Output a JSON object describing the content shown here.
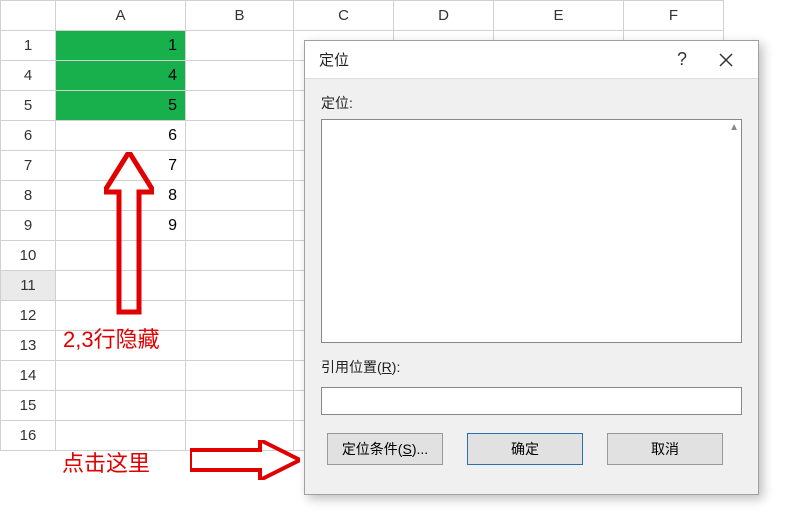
{
  "columns": [
    "A",
    "B",
    "C",
    "D",
    "E",
    "F"
  ],
  "rows": [
    {
      "hdr": "1",
      "a": "1",
      "green": true
    },
    {
      "hdr": "4",
      "a": "4",
      "green": true
    },
    {
      "hdr": "5",
      "a": "5",
      "green": true
    },
    {
      "hdr": "6",
      "a": "6"
    },
    {
      "hdr": "7",
      "a": "7"
    },
    {
      "hdr": "8",
      "a": "8"
    },
    {
      "hdr": "9",
      "a": "9"
    },
    {
      "hdr": "10",
      "a": ""
    },
    {
      "hdr": "11",
      "a": "",
      "selected": true
    },
    {
      "hdr": "12",
      "a": ""
    },
    {
      "hdr": "13",
      "a": ""
    },
    {
      "hdr": "14",
      "a": ""
    },
    {
      "hdr": "15",
      "a": ""
    },
    {
      "hdr": "16",
      "a": ""
    }
  ],
  "annotations": {
    "hidden_rows": "2,3行隐藏",
    "click_here": "点击这里"
  },
  "dialog": {
    "title": "定位",
    "goto_label_prefix": "定位",
    "ref_label_prefix": "引用位置(",
    "ref_accel": "R",
    "ref_label_suffix": "):",
    "ref_value": "",
    "btn_special_prefix": "定位条件(",
    "btn_special_accel": "S",
    "btn_special_suffix": ")...",
    "btn_ok": "确定",
    "btn_cancel": "取消"
  }
}
